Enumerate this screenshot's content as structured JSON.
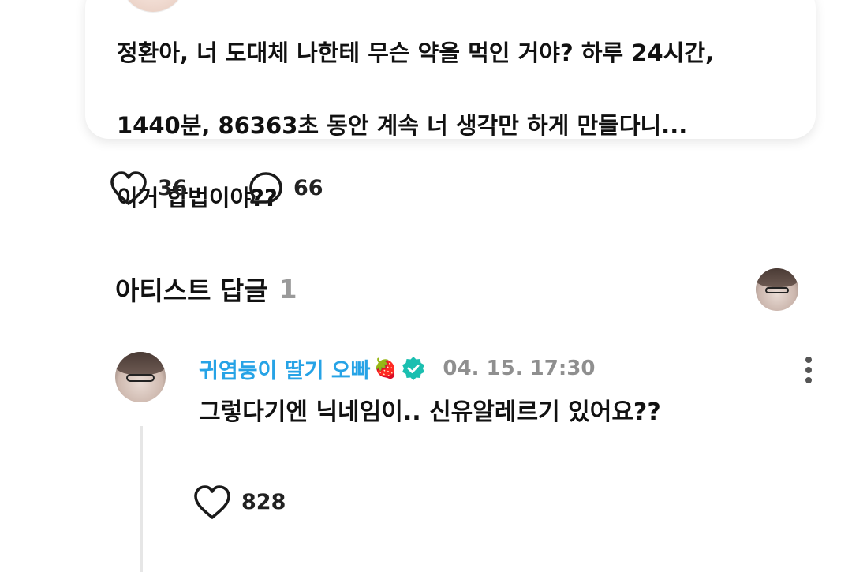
{
  "post": {
    "text_line1": "정환아, 너 도대체 나한테 무슨 약을 먹인 거야? 하루 24시간,",
    "text_line2": "1440분, 86363초 동안 계속 너 생각만 하게 만들다니...",
    "text_line3": "이거 합법이야??",
    "likes": "36",
    "comments": "66"
  },
  "artist_reply_section": {
    "title": "아티스트 답글",
    "count": "1"
  },
  "reply": {
    "author_name": "귀염둥이 딸기 오빠",
    "author_emoji": "🍓",
    "timestamp": "04. 15. 17:30",
    "body": "그렇다기엔 닉네임이.. 신유알레르기 있어요??",
    "likes": "828"
  },
  "colors": {
    "author_name": "#26a3e6",
    "verified_badge": "#1bbfb0",
    "timestamp": "#8f8f8f",
    "count_muted": "#9a9a9a"
  },
  "icons": [
    "heart-outline-icon",
    "comment-bubble-icon",
    "verified-badge-icon",
    "more-vertical-icon",
    "strawberry-emoji"
  ]
}
